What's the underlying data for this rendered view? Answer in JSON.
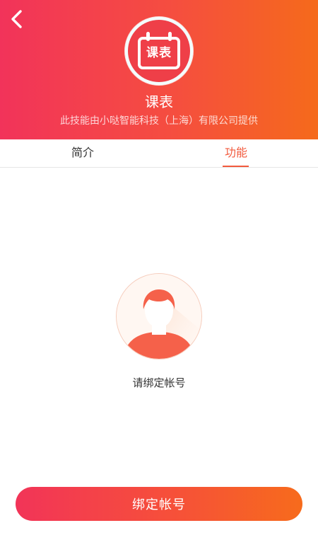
{
  "header": {
    "back_icon": "chevron-left-icon",
    "app_icon_label": "课表",
    "title": "课表",
    "provider": "此技能由小哒智能科技（上海）有限公司提供"
  },
  "tabs": [
    {
      "label": "简介",
      "active": false
    },
    {
      "label": "功能",
      "active": true
    }
  ],
  "content": {
    "avatar_icon": "user-avatar-icon",
    "hint": "请绑定帐号"
  },
  "footer": {
    "button_label": "绑定帐号"
  },
  "colors": {
    "accent": "#f25a3d",
    "gradient_start": "#f2335a",
    "gradient_end": "#f56a1b"
  }
}
